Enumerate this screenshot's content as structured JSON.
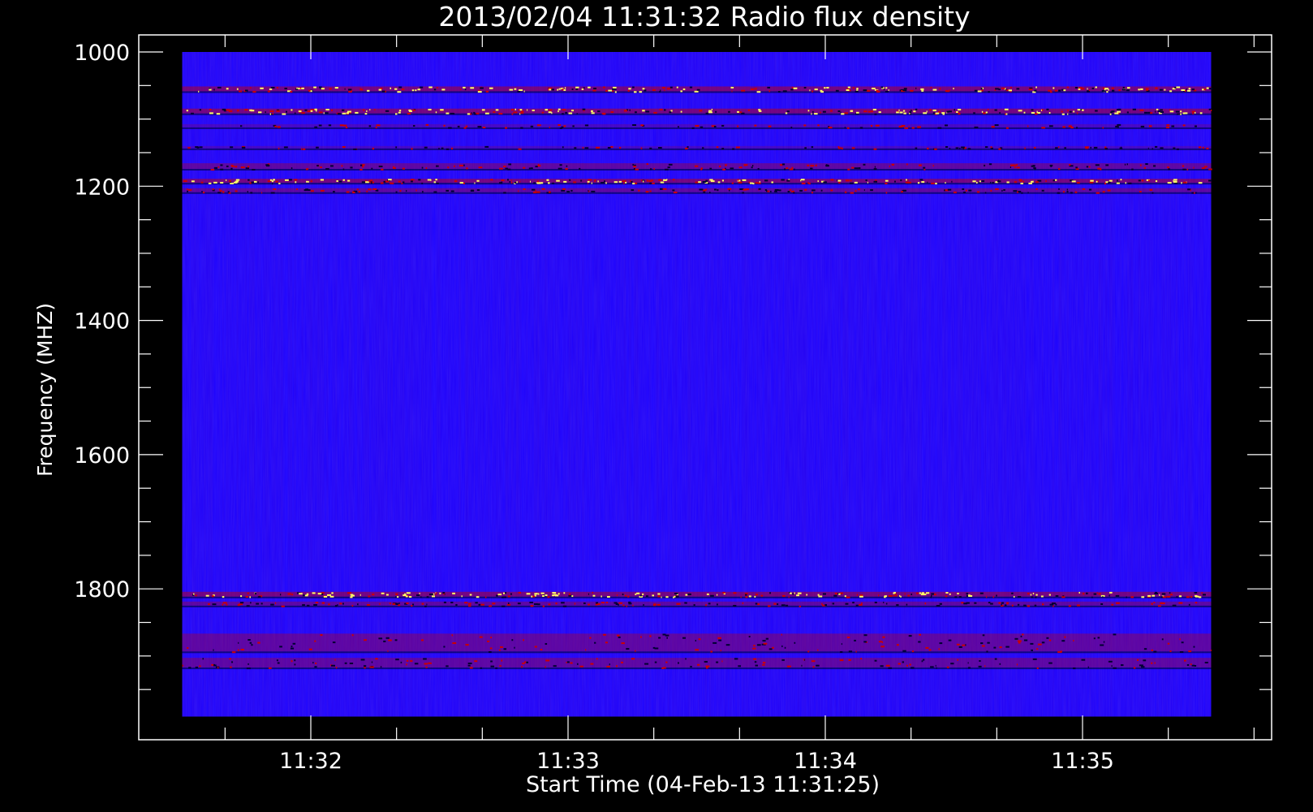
{
  "chart_data": {
    "type": "heatmap",
    "title": "2013/02/04 11:31:32 Radio flux density",
    "xlabel": "Start Time (04-Feb-13 11:31:25)",
    "ylabel": "Frequency (MHZ)",
    "x_axis": {
      "unit": "time",
      "range": [
        "11:31:25",
        "11:35:40"
      ],
      "major_ticks": [
        "11:32",
        "11:33",
        "11:34",
        "11:35"
      ],
      "minor_ticks": [
        "11:31:40",
        "11:32:20",
        "11:32:40",
        "11:33:20",
        "11:33:40",
        "11:34:20",
        "11:34:40",
        "11:35:20",
        "11:35:40"
      ]
    },
    "y_axis": {
      "range": [
        1000,
        2000
      ],
      "inverted": true,
      "major_ticks": [
        1000,
        1200,
        1400,
        1600,
        1800
      ],
      "minor_ticks": [
        1050,
        1100,
        1150,
        1250,
        1300,
        1350,
        1450,
        1500,
        1550,
        1650,
        1700,
        1750,
        1850,
        1900,
        1950
      ]
    },
    "data_extent": {
      "time_start": "11:31:30",
      "time_end": "11:35:30",
      "freq_min": 1000,
      "freq_max": 2000
    },
    "colors": {
      "background": "#1a00ff",
      "background_variation": "#2a10f0",
      "emission": "#cc0000",
      "strong": "#ffff66",
      "absorption": "#000033",
      "frame": "#ffffff",
      "page": "#000000"
    },
    "bands": [
      {
        "freq": 1055,
        "width": 6,
        "intensity": "strong"
      },
      {
        "freq": 1088,
        "width": 6,
        "intensity": "strong"
      },
      {
        "freq": 1110,
        "width": 4,
        "intensity": "weak"
      },
      {
        "freq": 1142,
        "width": 3,
        "intensity": "weak"
      },
      {
        "freq": 1170,
        "width": 7,
        "intensity": "medium"
      },
      {
        "freq": 1192,
        "width": 5,
        "intensity": "strong"
      },
      {
        "freq": 1206,
        "width": 5,
        "intensity": "medium"
      },
      {
        "freq": 1808,
        "width": 6,
        "intensity": "strong"
      },
      {
        "freq": 1822,
        "width": 5,
        "intensity": "medium"
      },
      {
        "freq": 1880,
        "width": 22,
        "intensity": "medium"
      },
      {
        "freq": 1910,
        "width": 12,
        "intensity": "medium"
      }
    ]
  }
}
